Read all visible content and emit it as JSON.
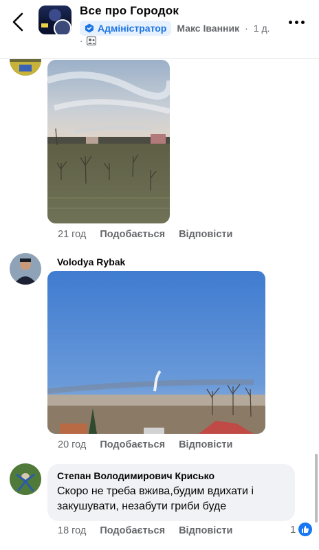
{
  "header": {
    "group_name": "Все про Городок",
    "admin_badge": "Адміністратор",
    "author": "Макс Іванник",
    "time": "1 д.",
    "dot": "·",
    "audience_icon": "group-audience-icon"
  },
  "comments": [
    {
      "author": "",
      "time": "21 год",
      "like_label": "Подобається",
      "reply_label": "Відповісти"
    },
    {
      "author": "Volodya Rybak",
      "time": "20 год",
      "like_label": "Подобається",
      "reply_label": "Відповісти"
    },
    {
      "author": "Степан Володимирович Крисько",
      "text": "Скоро не треба вжива,будим вдихати і закушувати, незабути гриби буде",
      "time": "18 год",
      "like_label": "Подобається",
      "reply_label": "Відповісти",
      "reactions": "1"
    }
  ],
  "colors": {
    "accent": "#1877f2",
    "secondary_text": "#65676b",
    "bubble": "#f0f2f5"
  }
}
